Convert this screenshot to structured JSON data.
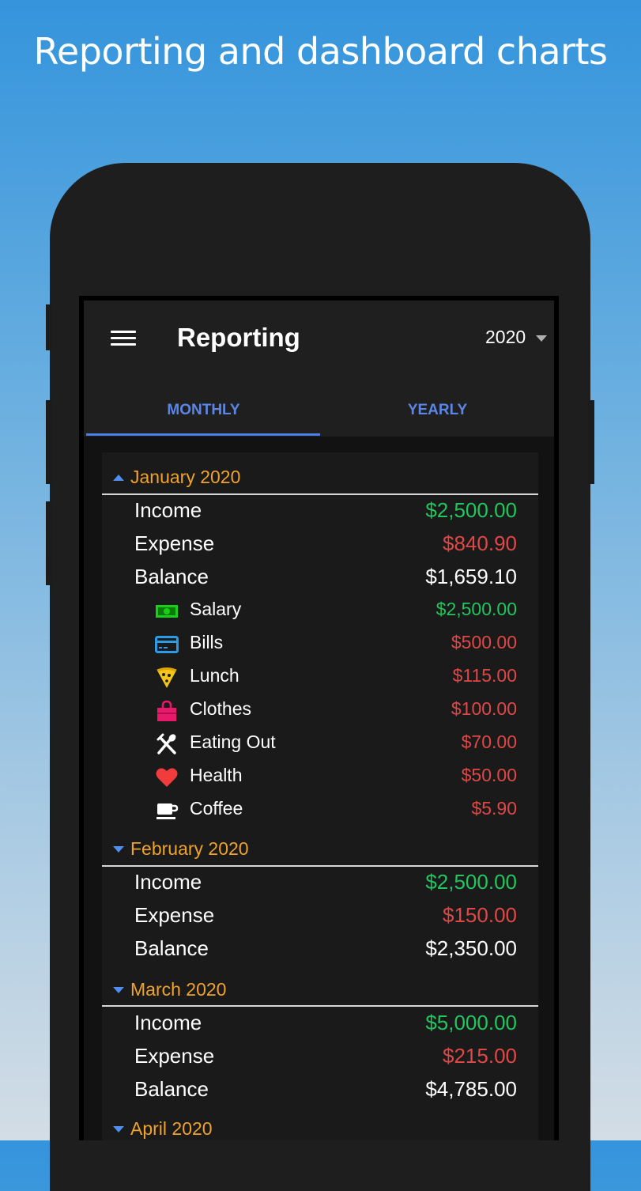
{
  "headline": "Reporting and dashboard charts",
  "appbar": {
    "title": "Reporting",
    "year": "2020"
  },
  "tabs": [
    {
      "label": "MONTHLY",
      "active": true
    },
    {
      "label": "YEARLY",
      "active": false
    }
  ],
  "colors": {
    "income": "#22c55e",
    "expense": "#e04848",
    "month": "#f0a22a",
    "accent": "#4b7ee8"
  },
  "months": [
    {
      "label": "January 2020",
      "expanded": true,
      "income": "$2,500.00",
      "expense": "$840.90",
      "balance": "$1,659.10",
      "labels": {
        "income": "Income",
        "expense": "Expense",
        "balance": "Balance"
      },
      "categories": [
        {
          "name": "Salary",
          "amount": "$2,500.00",
          "icon": "cash-icon"
        },
        {
          "name": "Bills",
          "amount": "$500.00",
          "icon": "credit-card-icon"
        },
        {
          "name": "Lunch",
          "amount": "$115.00",
          "icon": "pizza-icon"
        },
        {
          "name": "Clothes",
          "amount": "$100.00",
          "icon": "shopping-bag-icon"
        },
        {
          "name": "Eating Out",
          "amount": "$70.00",
          "icon": "fork-knife-icon"
        },
        {
          "name": "Health",
          "amount": "$50.00",
          "icon": "heart-icon"
        },
        {
          "name": "Coffee",
          "amount": "$5.90",
          "icon": "coffee-cup-icon"
        }
      ]
    },
    {
      "label": "February 2020",
      "expanded": false,
      "income": "$2,500.00",
      "expense": "$150.00",
      "balance": "$2,350.00",
      "labels": {
        "income": "Income",
        "expense": "Expense",
        "balance": "Balance"
      }
    },
    {
      "label": "March 2020",
      "expanded": false,
      "income": "$5,000.00",
      "expense": "$215.00",
      "balance": "$4,785.00",
      "labels": {
        "income": "Income",
        "expense": "Expense",
        "balance": "Balance"
      }
    },
    {
      "label": "April 2020",
      "expanded": false
    }
  ]
}
